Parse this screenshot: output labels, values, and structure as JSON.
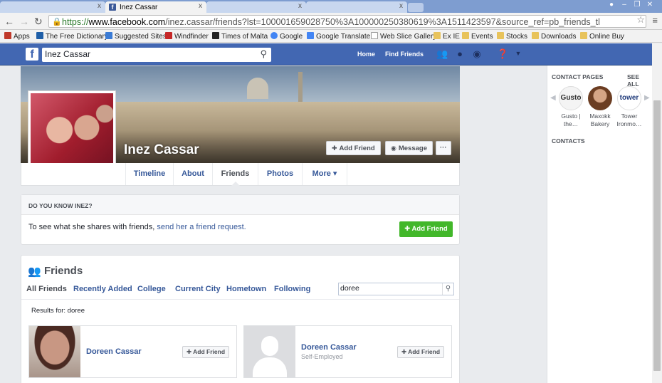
{
  "browser": {
    "tabs": [
      {
        "title": "",
        "close": "x"
      },
      {
        "title": "Inez Cassar",
        "close": "x"
      },
      {
        "title": "",
        "close": "x"
      },
      {
        "title": "",
        "close": "x"
      }
    ],
    "url_scheme": "https://",
    "url_host": "www.facebook.com",
    "url_path": "/inez.cassar/friends?lst=100001659028750%3A100000250380619%3A1511423597&source_ref=pb_friends_tl",
    "bookmarks": [
      {
        "label": "Apps",
        "color": "#c0392b"
      },
      {
        "label": "The Free Dictionary",
        "color": "#1f5fa8"
      },
      {
        "label": "Suggested Sites",
        "color": "#3a7bd5"
      },
      {
        "label": "Windfinder",
        "color": "#c62828"
      },
      {
        "label": "Times of Malta",
        "color": "#222222"
      },
      {
        "label": "Google",
        "color": "#4285f4"
      },
      {
        "label": "Google Translate",
        "color": "#4285f4"
      },
      {
        "label": "Web Slice Gallery",
        "color": "#ffffff"
      },
      {
        "label": "Ex IE",
        "color": "#e8c35b"
      },
      {
        "label": "Events",
        "color": "#e8c35b"
      },
      {
        "label": "Stocks",
        "color": "#e8c35b"
      },
      {
        "label": "Downloads",
        "color": "#e8c35b"
      },
      {
        "label": "Online Buy",
        "color": "#e8c35b"
      }
    ]
  },
  "fb": {
    "search_value": "Inez Cassar",
    "home": "Home",
    "find_friends": "Find Friends",
    "accent": "#4267b2"
  },
  "profile": {
    "name": "Inez Cassar",
    "add_friend": "Add Friend",
    "message": "Message",
    "more_dots": "···",
    "tabs": [
      "Timeline",
      "About",
      "Friends",
      "Photos",
      "More ▾"
    ]
  },
  "know": {
    "heading": "DO YOU KNOW INEZ?",
    "text": "To see what she shares with friends,",
    "link": "send her a friend request.",
    "button": "Add Friend"
  },
  "friends": {
    "title": "Friends",
    "tabs": [
      "All Friends",
      "Recently Added",
      "College",
      "Current City",
      "Hometown",
      "Following"
    ],
    "search_value": "doree",
    "results": "Results for: doree",
    "cards": [
      {
        "name": "Doreen Cassar",
        "sub": "",
        "button": "Add Friend"
      },
      {
        "name": "Doreen Cassar",
        "sub": "Self-Employed",
        "button": "Add Friend"
      }
    ]
  },
  "sidebar": {
    "contact_pages": "CONTACT PAGES",
    "see_all": "SEE ALL",
    "pages": [
      {
        "name": "Gusto | the…",
        "logo_text": "Gusto"
      },
      {
        "name": "Maxokk Bakery",
        "logo_text": ""
      },
      {
        "name": "Tower Ironmo…",
        "logo_text": "tower"
      }
    ],
    "contacts": "CONTACTS"
  }
}
